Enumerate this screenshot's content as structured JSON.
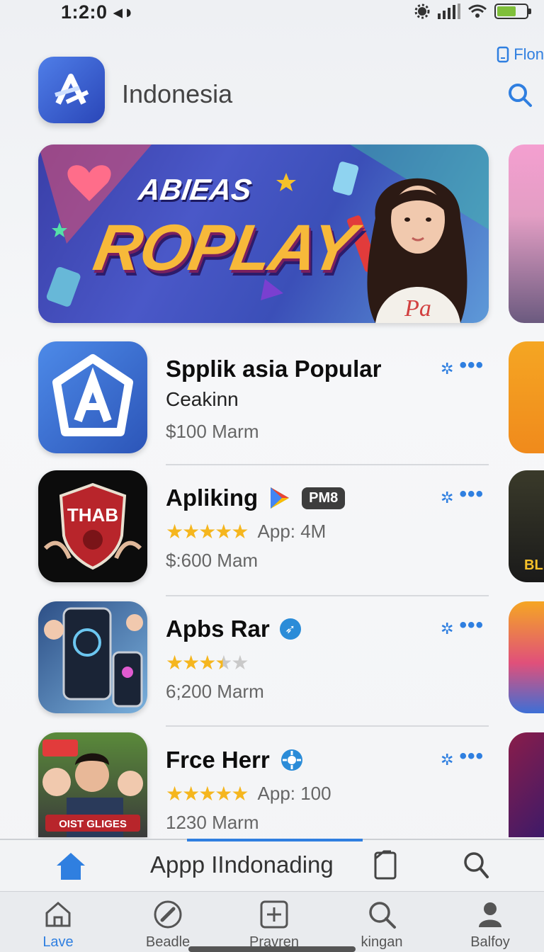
{
  "status_bar": {
    "time": "1:2:0 ◂◗",
    "icons": [
      "settings-icon",
      "signal-icon",
      "wifi-icon",
      "battery-icon"
    ]
  },
  "header": {
    "title": "Indonesia",
    "link_label": "Flon"
  },
  "banner": {
    "kicker": "ABIEAS",
    "title": "ROPLAY",
    "shirt_text": "Pa"
  },
  "apps": [
    {
      "name": "Spplik asia Popular",
      "subtitle": "Ceakinn",
      "price": "$100 Marm",
      "rating": null,
      "meta": ""
    },
    {
      "name": "Apliking",
      "badge": "PM8",
      "rating": 5,
      "meta": "App: 4M",
      "price": "$:600 Mam"
    },
    {
      "name": "Apbs Rar",
      "rating": 3.5,
      "meta": "",
      "price": "6;200 Marm"
    },
    {
      "name": "Frce Herr",
      "rating": 5,
      "meta": "App: 100",
      "price": "1230 Marm"
    }
  ],
  "app_icon_texts": {
    "shield": "THAB",
    "people": "OIST GLIGES",
    "sign": "BLI"
  },
  "toolbar": {
    "label": "Appp IIndonading"
  },
  "tabs": [
    {
      "label": "Lave",
      "icon": "home-outline-icon",
      "active": true
    },
    {
      "label": "Beadle",
      "icon": "edit-icon",
      "active": false
    },
    {
      "label": "Pravren",
      "icon": "add-box-icon",
      "active": false
    },
    {
      "label": "kingan",
      "icon": "search-icon",
      "active": false
    },
    {
      "label": "Balfoy",
      "icon": "person-icon",
      "active": false
    }
  ],
  "colors": {
    "accent": "#2f7fe0",
    "star": "#f5b61e"
  }
}
